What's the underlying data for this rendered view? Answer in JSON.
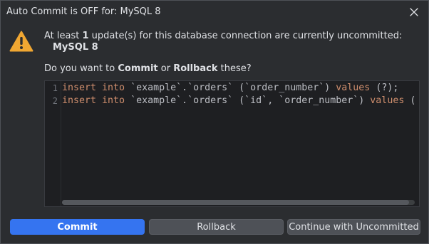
{
  "window": {
    "title": "Auto Commit is OFF for: MySQL 8"
  },
  "message": {
    "prefix": "At least ",
    "count": "1",
    "suffix": " update(s) for this database connection are currently uncommitted:",
    "connection_name": "MySQL 8"
  },
  "question": {
    "prefix": "Do you want to ",
    "commit_word": "Commit",
    "middle": " or ",
    "rollback_word": "Rollback",
    "suffix": " these?"
  },
  "editor": {
    "lines": [
      {
        "number": "1",
        "kw1": "insert into",
        "table": " `example`.`orders` (`order_number`) ",
        "kw2": "values",
        "rest": " (?);"
      },
      {
        "number": "2",
        "kw1": "insert into",
        "table": " `example`.`orders` (`id`, `order_number`) ",
        "kw2": "values",
        "rest": " ("
      }
    ]
  },
  "buttons": {
    "commit": "Commit",
    "rollback": "Rollback",
    "continue": "Continue with Uncommitted"
  },
  "icons": {
    "warning": "warning-icon",
    "close": "close-icon"
  },
  "colors": {
    "primary": "#3574f0",
    "warning": "#f0a732",
    "keyword": "#cf8e6d"
  }
}
